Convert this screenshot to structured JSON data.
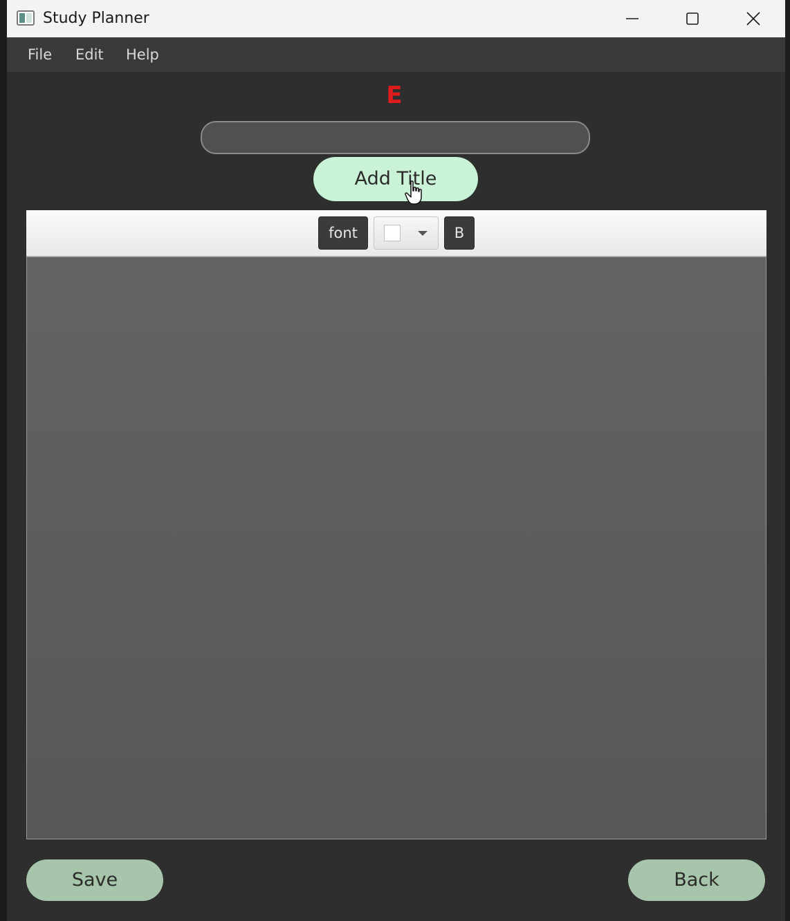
{
  "window": {
    "title": "Study Planner",
    "controls": [
      "minimize",
      "maximize",
      "close"
    ]
  },
  "menubar": {
    "items": [
      "File",
      "Edit",
      "Help"
    ]
  },
  "error_label": "E",
  "title_input": {
    "value": "",
    "placeholder": ""
  },
  "add_title_button": "Add Title",
  "toolbar": {
    "font_button": "font",
    "color_picker_value": "#ffffff",
    "bold_button": "B"
  },
  "editor": {
    "content": ""
  },
  "footer": {
    "save_button": "Save",
    "back_button": "Back"
  },
  "colors": {
    "background": "#2e2e2e",
    "error": "#e01b1b",
    "add_title_button": "#c9f2d7",
    "footer_buttons": "#a6c5ab",
    "editor_area": "#5e5e5e"
  },
  "icons": {
    "app": "app-window-icon",
    "minimize": "minimize-icon",
    "maximize": "maximize-icon",
    "close": "close-icon",
    "dropdown": "chevron-down-icon",
    "cursor": "hand-pointer-icon"
  }
}
